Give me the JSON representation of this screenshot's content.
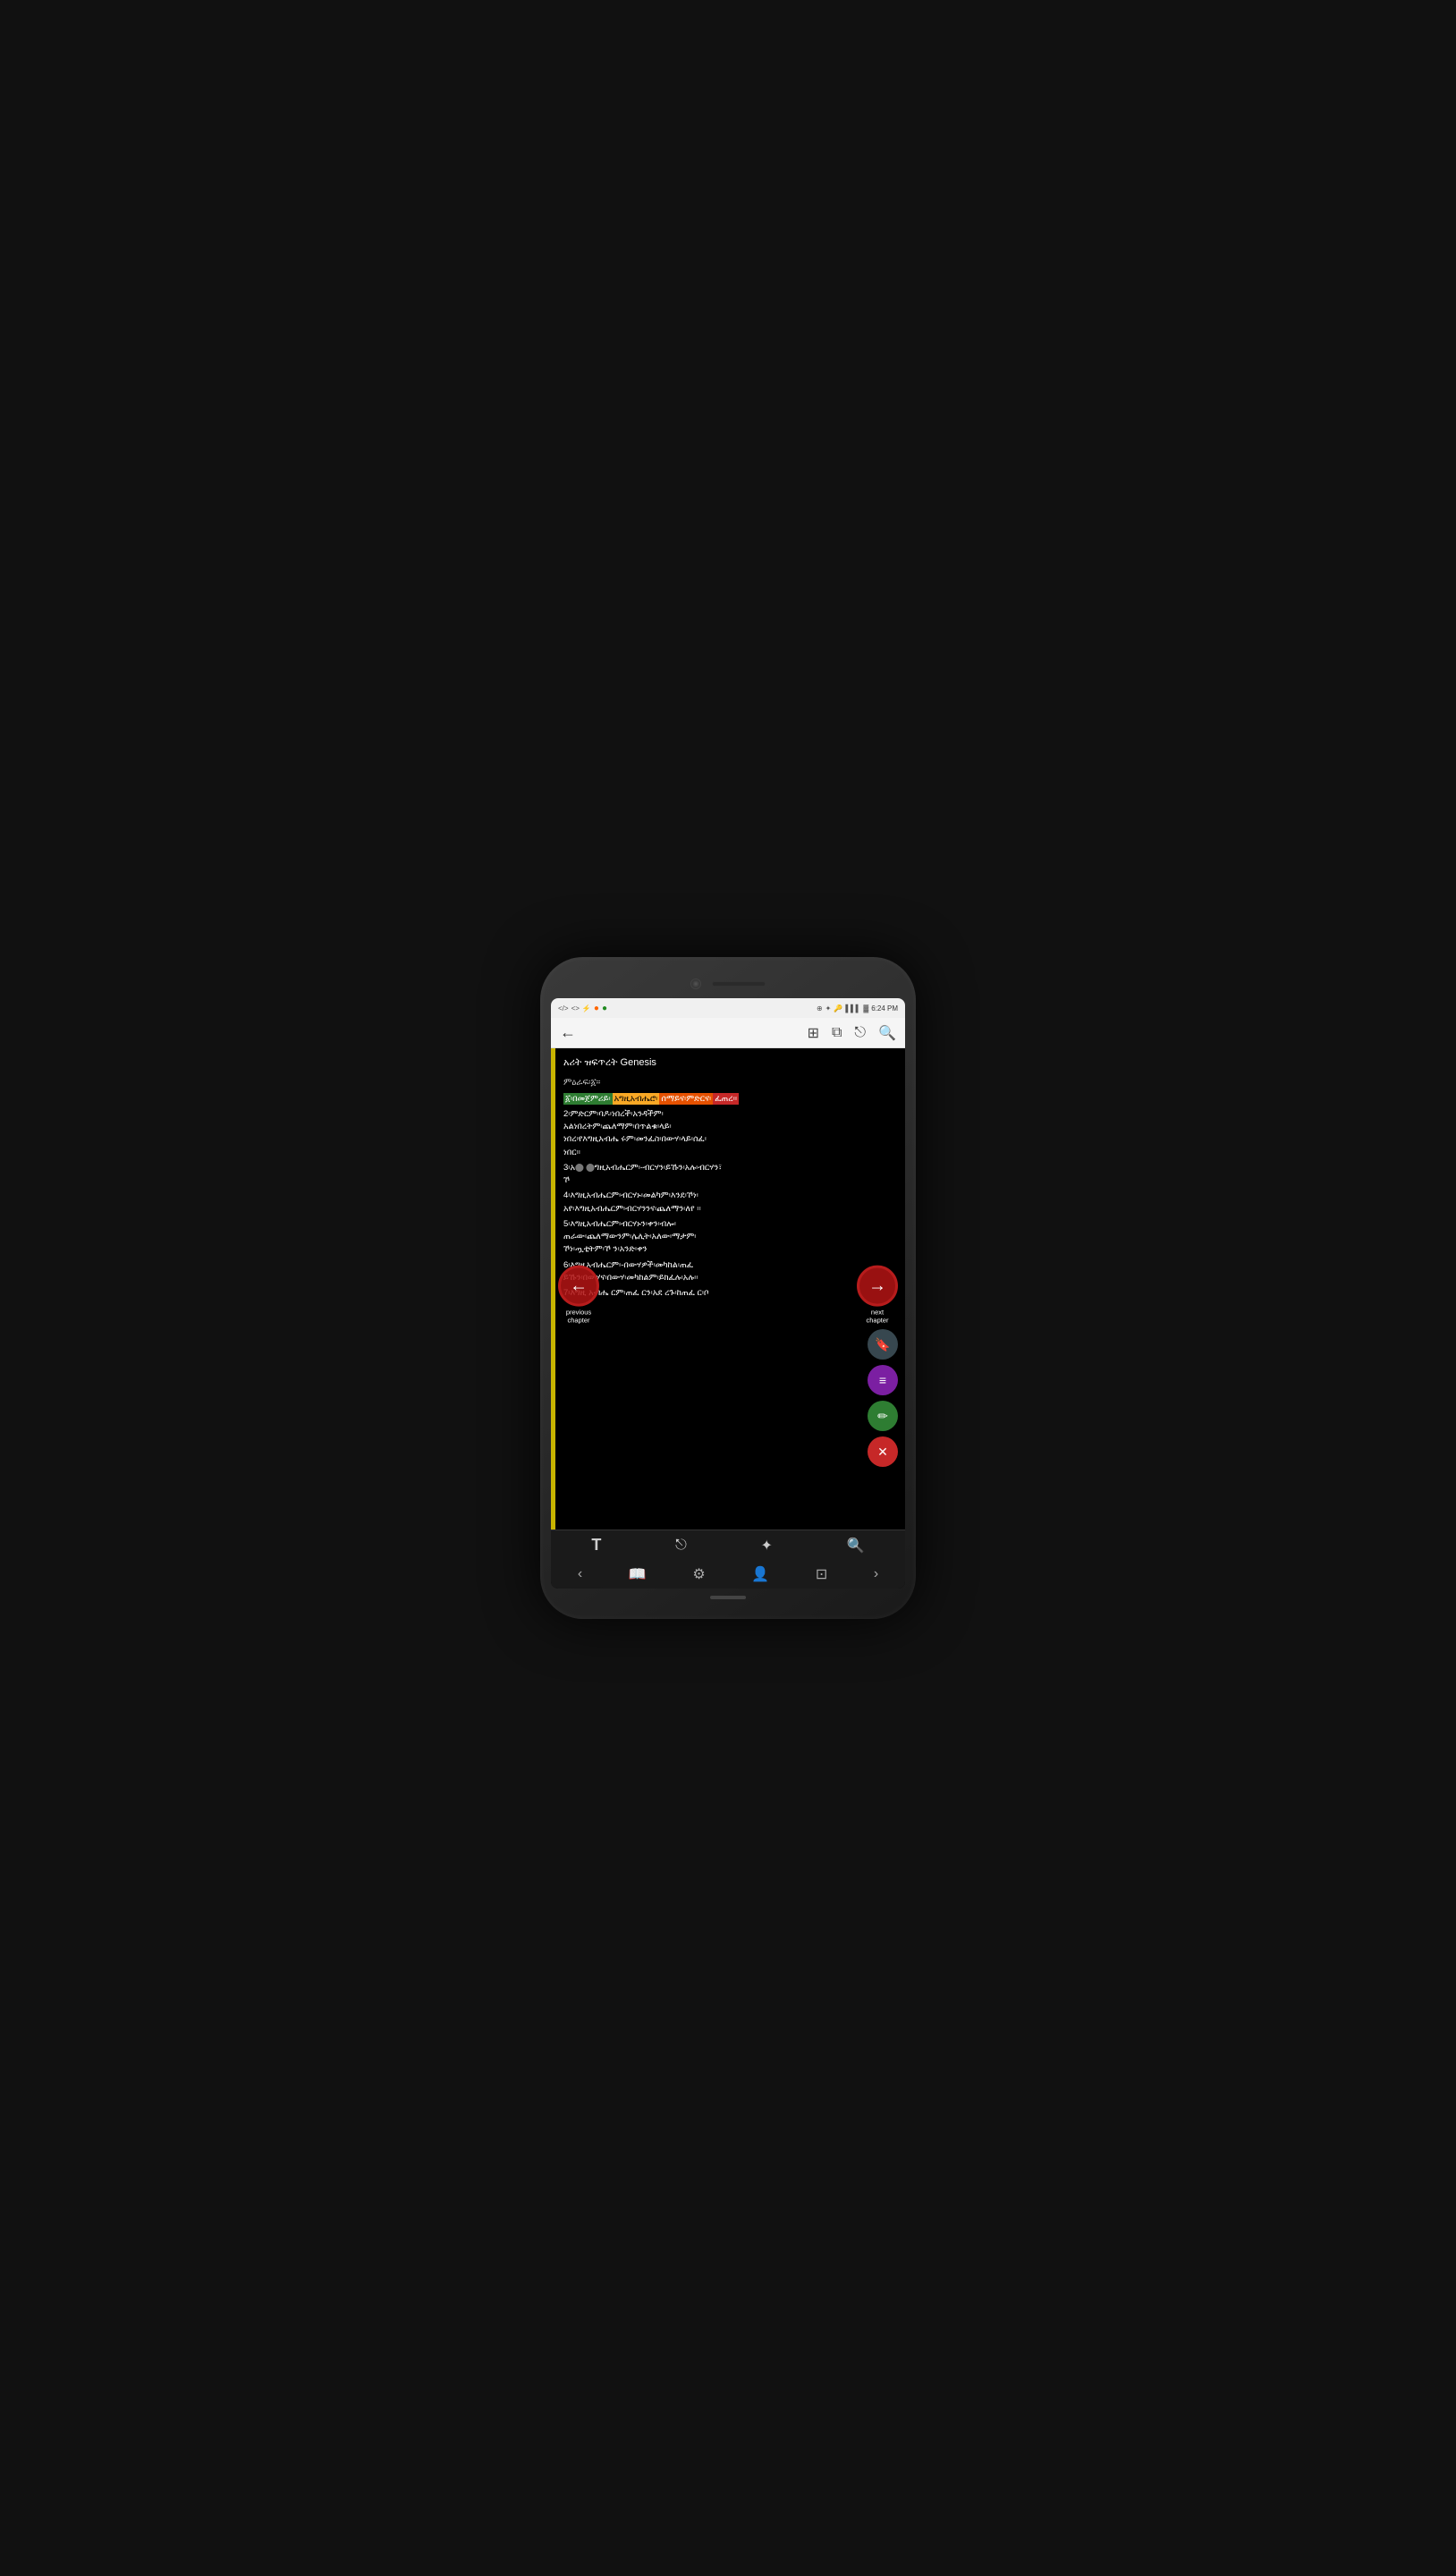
{
  "status_bar": {
    "time": "6:24 PM",
    "icons_left": [
      "⊞",
      "</>",
      "⚡",
      "😊",
      "🌱"
    ],
    "icons_right": [
      "⊕",
      "✦",
      "🔑",
      "✕",
      "📶",
      "🔋"
    ]
  },
  "toolbar": {
    "back_label": "←",
    "icon1": "⊞",
    "icon2": "⧉",
    "icon3": "⎋",
    "icon4": "🔍"
  },
  "content": {
    "title": "አሪት ዝፍጥረት Genesis",
    "verse_intro": "ምዕራፍ፡፩።",
    "verse1_parts": [
      {
        "text": "፩፡በመጀ",
        "highlight": "green"
      },
      {
        "text": "ምሪይ፡",
        "highlight": "green"
      },
      {
        "text": "አግዚአብሔሮ፡",
        "highlight": "yellow"
      },
      {
        "text": "ሰማይና፡ምድርና፡",
        "highlight": "orange"
      },
      {
        "text": "ፈጠረ፡፡",
        "highlight": "red"
      }
    ],
    "verse2": "2፡ምድርም፡ባዶ፡ነበረች፡አንዳችም፡አልነበረትም፡ጨለማም፡በጥልቁ፡ላይ፡ነበረ፡የእግዚአብሔ ሩም፡መንፈስ፡በውሃ፡ላይ፡ሰፈ፡ ነበር።",
    "verse3": "3፡አ",
    "verse3b": "ሚ",
    "verse3_text": "ግዚአብሔርም፡-ብርሃን፡ይኹን፡አሉ፡ብርሃንም፡ ኾነ",
    "verse4": "4፡እግዚአብሔርም፡ብርሃኑ፡መልካም፡እንደ፡ኾነ፡ አየ፡እግዚአብሔርም፡ብርሃንንና፡ጨለማን፡ለየ ።",
    "verse5": "5፡እግዚአብሔርም፡ብርሃኑን፡ቀን፡ብሎ፡ ጠራው፡ጨለማውንም፡ሌሊት፡አለው፡ማታም፡ ኾነ፡ጧቲትም፡ኾ ን፡አንድ፡ቀን",
    "verse6": "6፡እግዚአብሔርም፡-በውሃዎች፡መካከል፡ጠፈ ይኹን፡በውሃና፡በውሃ፡መካከልም፡ይክፈሉ፡አሉ፡፡",
    "verse7": "7፡እግዚ አብሔ ርም፡ጠፈ ርን፡አደ ረጉ፡ከጠፈ ር፡ቦ"
  },
  "navigation": {
    "prev_label": "previous\nchapter",
    "next_label": "next\nchapter",
    "prev_arrow": "←",
    "next_arrow": "→"
  },
  "fab_buttons": {
    "bookmark": "🔖",
    "list": "≡",
    "edit": "✏",
    "close": "✕"
  },
  "bottom_toolbar": {
    "icons": [
      "T",
      "⎋",
      "✦",
      "🔍"
    ]
  },
  "footer_nav": {
    "icons": [
      "‹",
      "📖",
      "⚙",
      "👤",
      "⊡",
      "›"
    ]
  }
}
